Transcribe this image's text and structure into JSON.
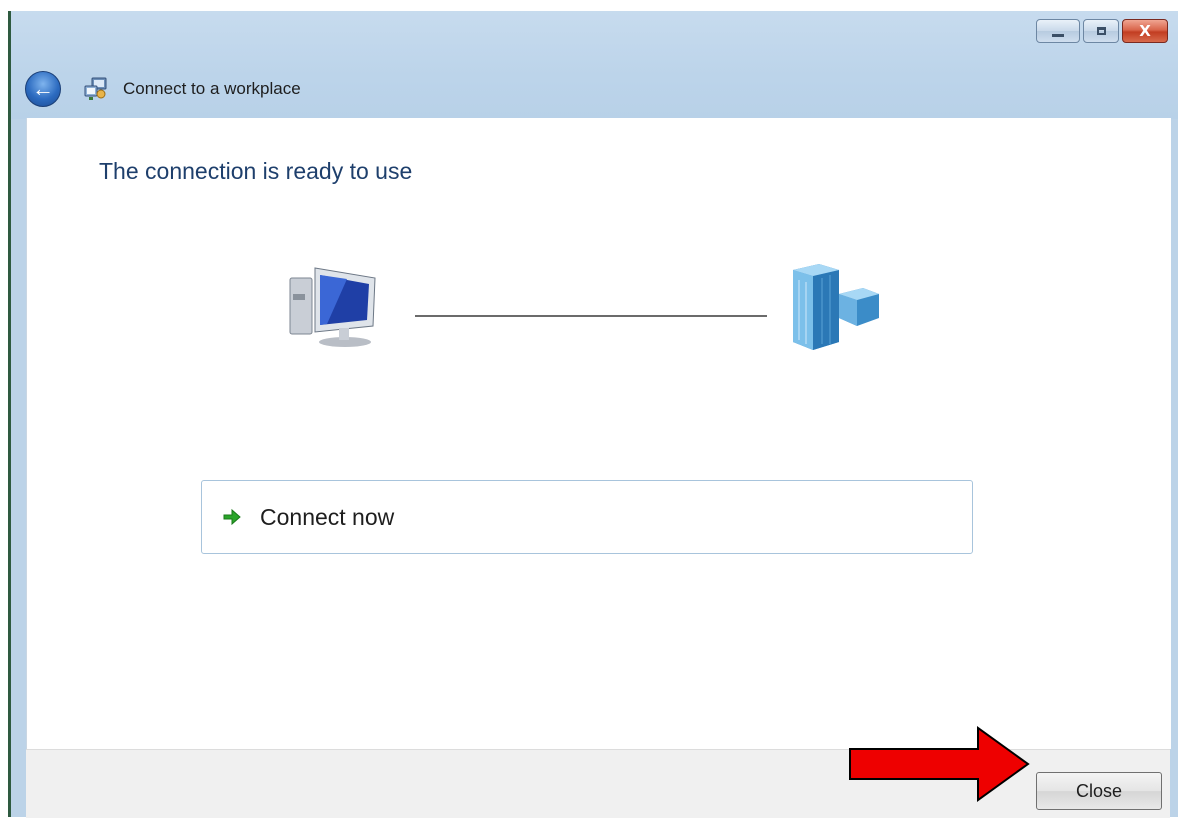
{
  "window": {
    "title": "Connect to a workplace",
    "controls": {
      "minimize": "minimize",
      "maximize": "maximize",
      "close_glyph": "X"
    }
  },
  "main": {
    "heading": "The connection is ready to use",
    "connect_now_label": "Connect now",
    "icons": {
      "computer": "computer-icon",
      "workplace": "office-building-icon",
      "connect_arrow": "green-arrow-icon"
    }
  },
  "footer": {
    "close_label": "Close"
  },
  "colors": {
    "heading": "#1e3f6c",
    "title_bar": "#bcd3e8",
    "annotation_arrow": "#ee0000"
  }
}
